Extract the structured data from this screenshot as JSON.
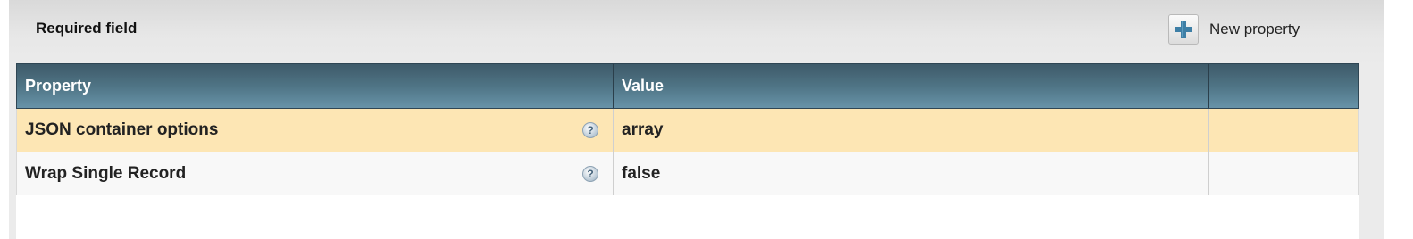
{
  "header": {
    "title": "Required field",
    "new_property_label": "New property"
  },
  "table": {
    "columns": [
      "Property",
      "Value",
      ""
    ],
    "rows": [
      {
        "property": "JSON container options",
        "value": "array",
        "selected": true
      },
      {
        "property": "Wrap Single Record",
        "value": "false",
        "selected": false
      }
    ]
  },
  "icons": {
    "add": "plus-icon",
    "help": "help-icon"
  },
  "colors": {
    "header_gradient_top": "#3e5a69",
    "header_gradient_bottom": "#6793a8",
    "selected_row": "#fde6b4",
    "plus_icon": "#3e7fa6"
  }
}
